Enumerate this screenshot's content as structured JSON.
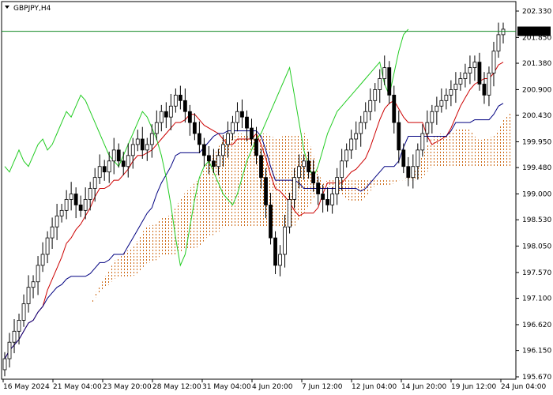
{
  "symbol_label": "GBPJPY,H4",
  "colors": {
    "tenkan": "#cc0000",
    "kijun": "#000080",
    "chikou": "#22cc22",
    "cloud": "#cc6611",
    "candle": "#000000",
    "price_line": "#118822",
    "price_tag_bg": "#000000",
    "price_tag_text": "#ffffff"
  },
  "chart_data": {
    "type": "candlestick",
    "ylim": [
      195.67,
      202.33
    ],
    "y_ticks": [
      "202.330",
      "201.850",
      "201.380",
      "200.900",
      "200.430",
      "199.950",
      "199.480",
      "199.000",
      "198.530",
      "198.050",
      "197.570",
      "197.100",
      "196.620",
      "196.150",
      "195.670"
    ],
    "x_ticks": [
      "16 May 2024",
      "21 May 04:00",
      "23 May 20:00",
      "28 May 12:00",
      "31 May 04:00",
      "4 Jun 20:00",
      "7 Jun 12:00",
      "12 Jun 04:00",
      "14 Jun 20:00",
      "19 Jun 12:00",
      "24 Jun 04:00"
    ],
    "current_price": 201.962,
    "current_price_label": "201.962",
    "close": [
      196.0,
      196.3,
      196.5,
      196.7,
      197.0,
      197.3,
      197.4,
      197.7,
      197.9,
      198.2,
      198.4,
      198.6,
      198.7,
      198.9,
      199.0,
      198.8,
      198.7,
      198.9,
      199.1,
      199.3,
      199.5,
      199.4,
      199.6,
      199.8,
      199.6,
      199.5,
      199.7,
      199.9,
      200.0,
      199.8,
      199.9,
      200.1,
      200.3,
      200.5,
      200.4,
      200.6,
      200.8,
      200.7,
      200.5,
      200.3,
      200.1,
      199.9,
      199.7,
      199.6,
      199.5,
      199.7,
      199.9,
      200.1,
      200.3,
      200.5,
      200.4,
      200.2,
      200.0,
      199.7,
      199.3,
      198.8,
      198.2,
      197.7,
      197.9,
      198.4,
      198.9,
      199.3,
      199.5,
      199.6,
      199.4,
      199.2,
      199.0,
      198.9,
      198.8,
      199.0,
      199.3,
      199.6,
      199.8,
      200.0,
      200.1,
      200.3,
      200.5,
      200.7,
      200.9,
      201.1,
      201.3,
      200.8,
      200.3,
      199.8,
      199.5,
      199.3,
      199.5,
      199.8,
      200.1,
      200.3,
      200.5,
      200.6,
      200.7,
      200.8,
      200.9,
      201.0,
      201.1,
      201.2,
      201.3,
      201.4,
      201.0,
      200.8,
      201.2,
      201.6,
      201.9,
      202.0
    ]
  }
}
